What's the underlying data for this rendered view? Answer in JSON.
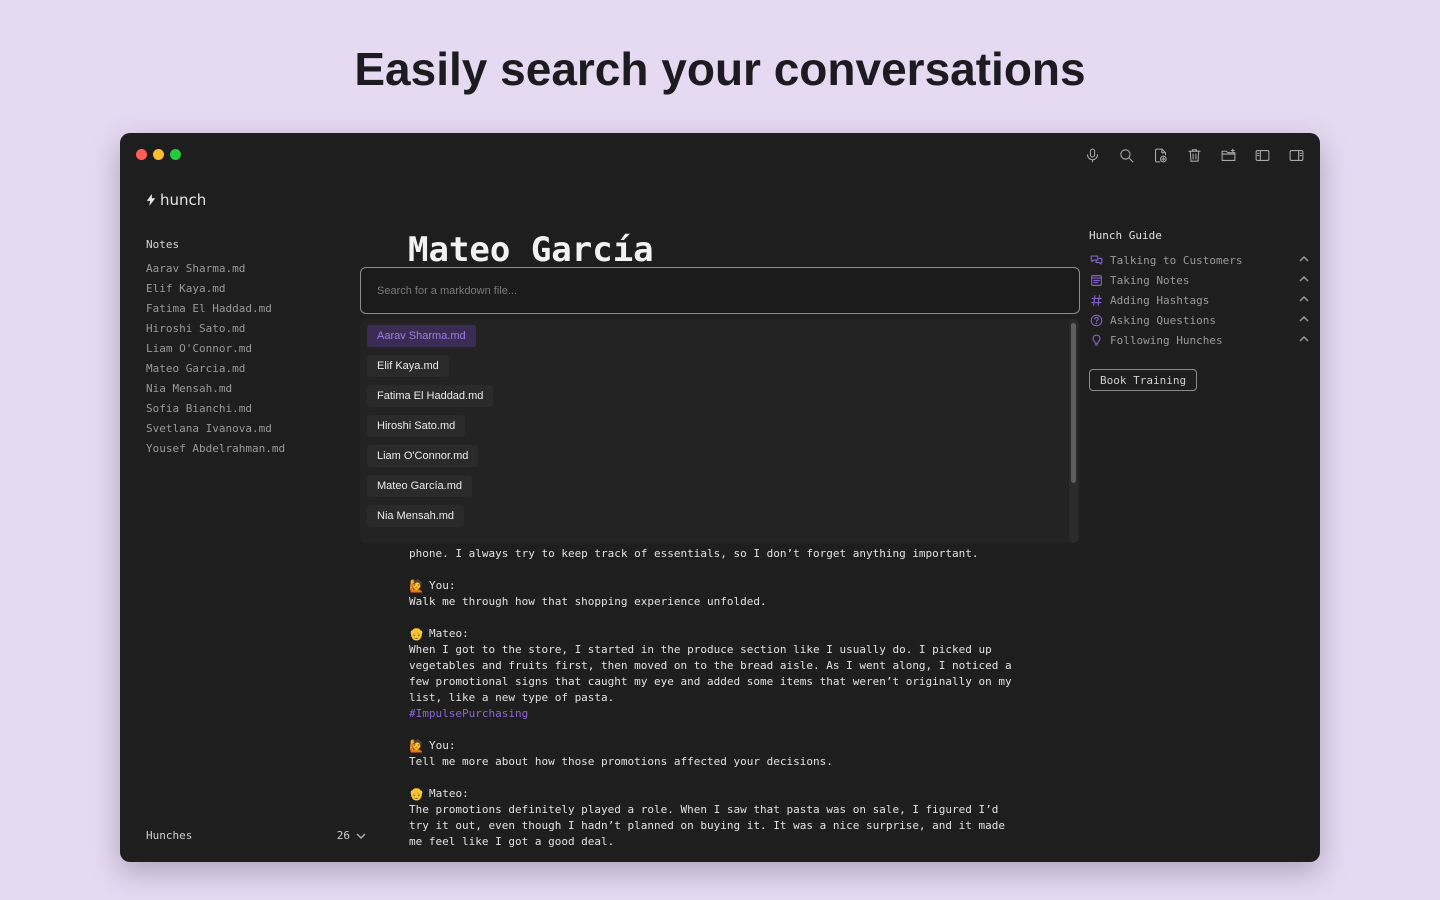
{
  "headline": "Easily search your conversations",
  "app": {
    "logo_text": "hunch"
  },
  "sidebar": {
    "section_title": "Notes",
    "notes": [
      "Aarav Sharma.md",
      "Elif Kaya.md",
      "Fatima El Haddad.md",
      "Hiroshi Sato.md",
      "Liam O'Connor.md",
      "Mateo Garcia.md",
      "Nia Mensah.md",
      "Sofia Bianchi.md",
      "Svetlana Ivanova.md",
      "Yousef Abdelrahman.md"
    ],
    "footer_label": "Hunches",
    "footer_count": "26"
  },
  "document": {
    "title": "Mateo García"
  },
  "search": {
    "placeholder": "Search for a markdown file...",
    "results": [
      "Aarav Sharma.md",
      "Elif Kaya.md",
      "Fatima El Haddad.md",
      "Hiroshi Sato.md",
      "Liam O'Connor.md",
      "Mateo García.md",
      "Nia Mensah.md"
    ]
  },
  "conversation": {
    "intro_tail": "phone. I always try to keep track of essentials, so I don’t forget anything important.",
    "turns": [
      {
        "speaker": "You:",
        "icon": "person-raising-hand-icon",
        "text": "Walk me through how that shopping experience unfolded."
      },
      {
        "speaker": "Mateo:",
        "icon": "older-man-icon",
        "text": "When I got to the store, I started in the produce section like I usually do. I picked up\nvegetables and fruits first, then moved on to the bread aisle. As I went along, I noticed a\nfew promotional signs that caught my eye and added some items that weren’t originally on my\nlist, like a new type of pasta.",
        "hashtag": "#ImpulsePurchasing"
      },
      {
        "speaker": "You:",
        "icon": "person-raising-hand-icon",
        "text": "Tell me more about how those promotions affected your decisions."
      },
      {
        "speaker": "Mateo:",
        "icon": "older-man-icon",
        "text": "The promotions definitely played a role. When I saw that pasta was on sale, I figured I’d\ntry it out, even though I hadn’t planned on buying it. It was a nice surprise, and it made\nme feel like I got a good deal."
      }
    ]
  },
  "guide": {
    "title": "Hunch Guide",
    "items": [
      {
        "label": "Talking to Customers",
        "icon": "chat-bubbles-icon"
      },
      {
        "label": "Taking Notes",
        "icon": "notes-icon"
      },
      {
        "label": "Adding Hashtags",
        "icon": "hashtag-icon"
      },
      {
        "label": "Asking Questions",
        "icon": "question-icon"
      },
      {
        "label": "Following Hunches",
        "icon": "lightbulb-icon"
      }
    ],
    "button_label": "Book Training"
  },
  "colors": {
    "accent": "#8e63d6",
    "window_bg": "#1e1e1e",
    "page_bg": "#e6daf3"
  }
}
